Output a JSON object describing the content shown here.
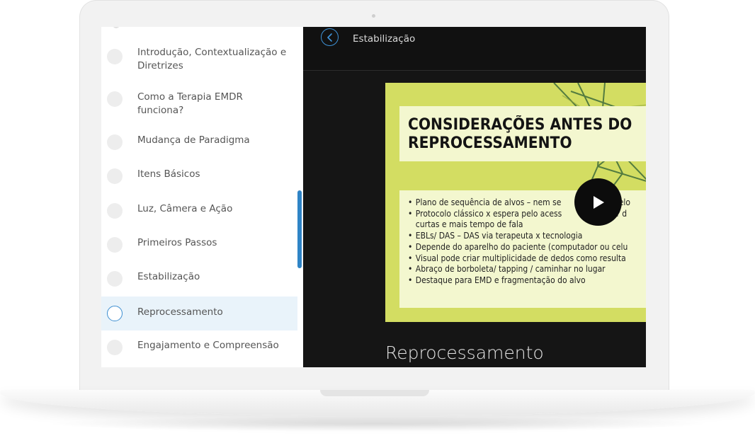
{
  "header": {
    "title": "Estabilização",
    "back_icon": "chevron-left-icon"
  },
  "sidebar": {
    "items": [
      {
        "label": "Introdução, Contextualização e Diretrizes",
        "status": "incomplete"
      },
      {
        "label": "Como a Terapia EMDR funciona?",
        "status": "incomplete"
      },
      {
        "label": "Mudança de Paradigma",
        "status": "incomplete"
      },
      {
        "label": "Itens Básicos",
        "status": "incomplete"
      },
      {
        "label": "Luz, Câmera e Ação",
        "status": "incomplete"
      },
      {
        "label": "Primeiros Passos",
        "status": "incomplete"
      },
      {
        "label": "Estabilização",
        "status": "incomplete"
      },
      {
        "label": "Reprocessamento",
        "status": "active"
      },
      {
        "label": "Engajamento e Compreensão",
        "status": "incomplete"
      }
    ]
  },
  "video": {
    "slide_title_line1": "CONSIDERAÇÕES ANTES DO",
    "slide_title_line2": "REPROCESSAMENTO",
    "bullets": [
      "Plano de sequência de alvos – nem se",
      "r pelo",
      "Protocolo clássico x espera pelo acess",
      "maior d",
      "curtas e mais tempo de fala",
      "EBLs/ DAS – DAS via terapeuta x tecnologia",
      "Depende do aparelho do paciente (computador ou celu",
      "Visual pode criar multiplicidade de dedos como resulta",
      "Abraço de borboleta/ tapping / caminhar no lugar",
      "Destaque para EMD e fragmentação do alvo"
    ],
    "play_icon": "play-icon",
    "lesson_title": "Reprocessamento"
  },
  "colors": {
    "accent": "#3d8ed1",
    "slide_background": "#d3dd62",
    "slide_panel": "#f3f7cf",
    "video_background": "#151515"
  }
}
